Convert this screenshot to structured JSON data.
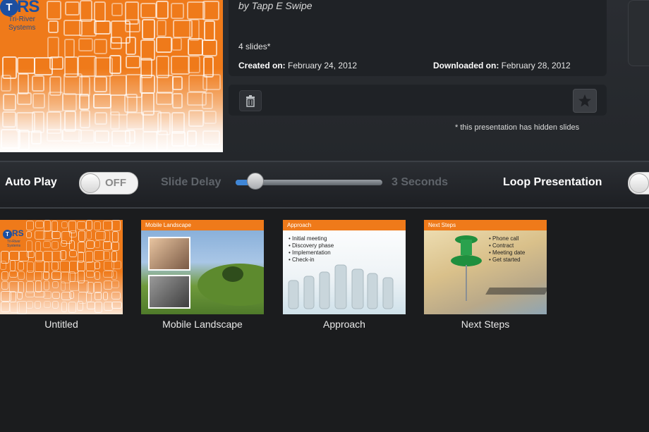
{
  "presentation": {
    "cover_logo": {
      "initial": "T",
      "rest": "RS",
      "subtitle_line1": "Tri-River",
      "subtitle_line2": "Systems"
    },
    "author": "by Tapp E Swipe",
    "slides_count": "4 slides*",
    "created_label": "Created on:",
    "created_value": "February 24, 2012",
    "downloaded_label": "Downloaded on:",
    "downloaded_value": "February 28, 2012",
    "hidden_note": "* this presentation has hidden slides"
  },
  "icons": {
    "trash": "trash-icon",
    "star": "star-icon"
  },
  "controls": {
    "auto_play_label": "Auto Play",
    "auto_play_state": "OFF",
    "slide_delay_label": "Slide Delay",
    "slide_delay_value": "3 Seconds",
    "slide_delay_fraction": 0.1,
    "loop_label": "Loop Presentation"
  },
  "thumbnails": [
    {
      "caption": "Untitled",
      "header": ""
    },
    {
      "caption": "Mobile Landscape",
      "header": "Mobile Landscape"
    },
    {
      "caption": "Approach",
      "header": "Approach",
      "bullets": [
        "Initial meeting",
        "Discovery phase",
        "Implementation",
        "Check-in"
      ]
    },
    {
      "caption": "Next Steps",
      "header": "Next Steps",
      "bullets": [
        "Phone call",
        "Contract",
        "Meeting date",
        "Get started"
      ]
    }
  ],
  "colors": {
    "accent_orange": "#ef7a1a",
    "slider_blue": "#3f86d6",
    "background": "#1b1c1e"
  }
}
